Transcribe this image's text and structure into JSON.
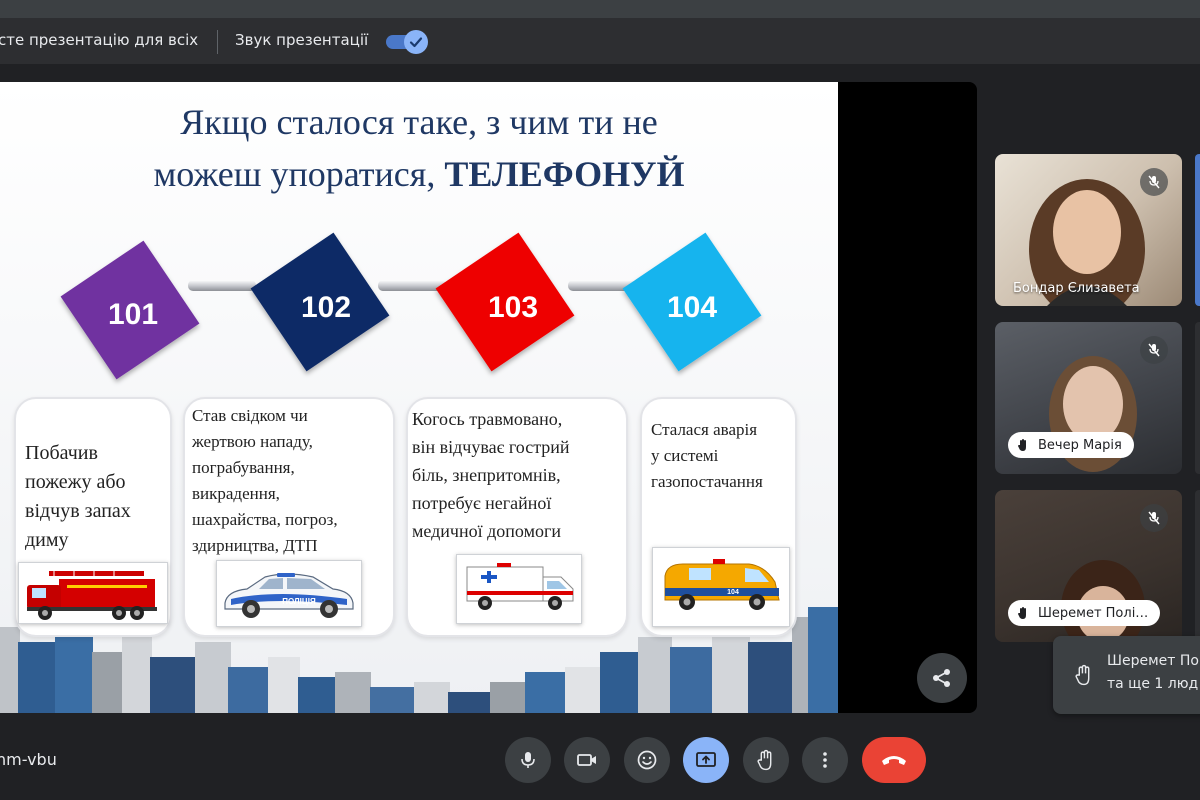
{
  "topbar": {
    "present_label": "сте презентацію для всіх",
    "sound_label": "Звук презентації",
    "sound_on": true
  },
  "slide": {
    "title_line1": "Якщо сталося таке, з чим ти не",
    "title_line2_prefix": "можеш упоратися, ",
    "title_line2_emph": "ТЕЛЕФОНУЙ",
    "numbers": [
      {
        "label": "101",
        "color": "#7030a0"
      },
      {
        "label": "102",
        "color": "#0e2a66"
      },
      {
        "label": "103",
        "color": "#ee0000"
      },
      {
        "label": "104",
        "color": "#16b4ee"
      }
    ],
    "cards": [
      {
        "text": "Побачив\nпожежу або\nвідчув запах\nдиму"
      },
      {
        "text": "Став свідком чи\nжертвою нападу,\nпограбування,\nвикрадення,\nшахрайства, погроз,\nздирництва, ДТП"
      },
      {
        "text": "Когось травмовано,\nвін відчуває гострий\nбіль, знепритомнів,\nпотребує негайної\nмедичної допомоги"
      },
      {
        "text": "Сталася аварія\nу системі\nгазопостачання"
      }
    ],
    "police_text": "ПОЛІЦІЯ",
    "gas_text": "104"
  },
  "participants": [
    {
      "name": "Бондар Єлизавета",
      "muted": true
    },
    {
      "name": "Вечер Марія",
      "muted": true,
      "hand_raised": true
    },
    {
      "name": "Шеремет Полі…",
      "muted": true,
      "hand_raised": true
    }
  ],
  "toast": {
    "line1": "Шеремет По",
    "line2": "та ще 1 люд"
  },
  "meeting_code": "nm-vbu",
  "colors": {
    "accent": "#8ab4f8",
    "end_call": "#ea4335",
    "control_bg": "#3c4043"
  }
}
